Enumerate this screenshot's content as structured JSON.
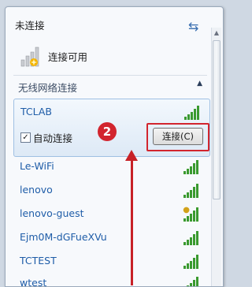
{
  "header": {
    "status": "未连接",
    "available": "连接可用"
  },
  "section": {
    "title": "无线网络连接"
  },
  "selected_network": {
    "name": "TCLAB",
    "auto_connect_label": "自动连接",
    "auto_connect_checked": "✓",
    "connect_button": "连接(C)",
    "annotation_number": "2"
  },
  "networks": [
    {
      "name": "Le-WiFi"
    },
    {
      "name": "lenovo"
    },
    {
      "name": "lenovo-guest"
    },
    {
      "name": "Ejm0M-dGFueXVu"
    },
    {
      "name": "TCTEST"
    },
    {
      "name": "wtest"
    }
  ],
  "colors": {
    "accent": "#1f5da8",
    "signal": "#3a9a2f",
    "annotation": "#d2252e"
  }
}
